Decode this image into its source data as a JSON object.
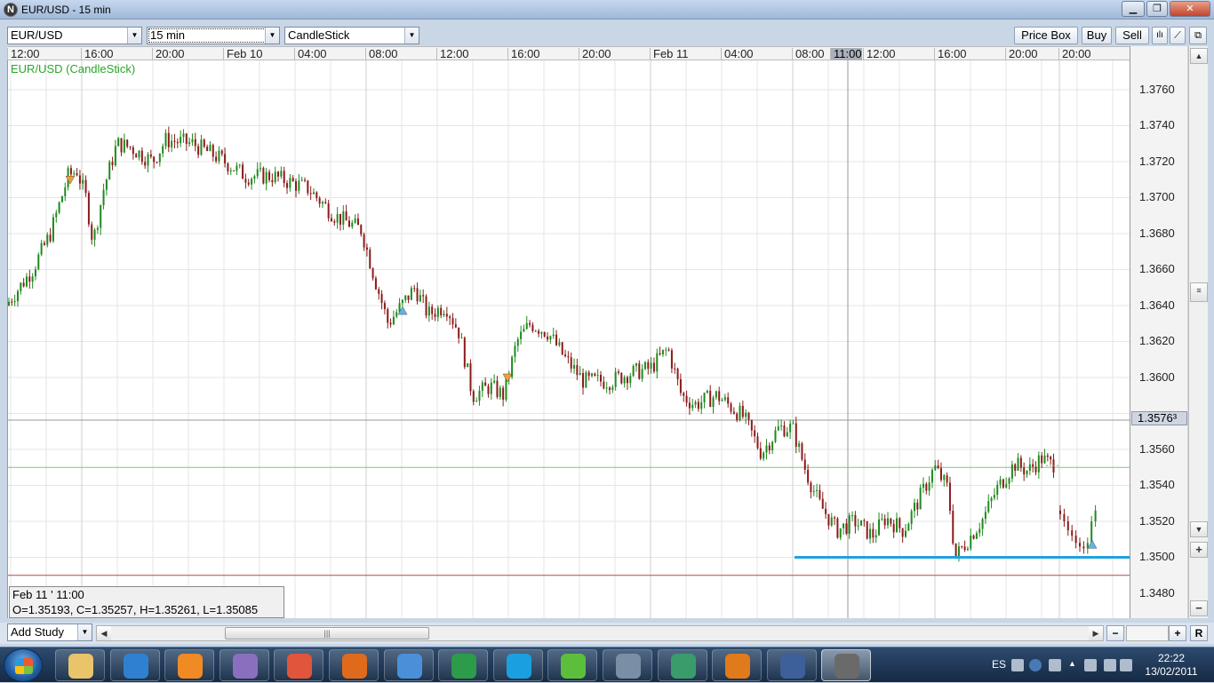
{
  "window": {
    "title": "EUR/USD - 15 min",
    "controls": {
      "minimize": "▁",
      "maximize": "❐",
      "close": "✕"
    }
  },
  "toolbar": {
    "symbol": "EUR/USD",
    "interval": "15 min",
    "chart_type": "CandleStick",
    "price_box_label": "Price Box",
    "buy_label": "Buy",
    "sell_label": "Sell"
  },
  "chart": {
    "series_label": "EUR/USD (CandleStick)",
    "time_labels": [
      "12:00",
      "16:00",
      "20:00",
      "Feb 10",
      "04:00",
      "08:00",
      "12:00",
      "16:00",
      "20:00",
      "Feb 11",
      "04:00",
      "08:00",
      "11:00",
      "12:00",
      "16:00",
      "20:00",
      "20:00"
    ],
    "highlighted_time": "11:00",
    "price_labels": [
      "1.3760",
      "1.3740",
      "1.3720",
      "1.3700",
      "1.3680",
      "1.3660",
      "1.3640",
      "1.3620",
      "1.3600",
      "1.3560",
      "1.3540",
      "1.3520",
      "1.3500",
      "1.3480"
    ],
    "current_price": "1.3576³",
    "support_level": 1.35,
    "colors": {
      "bull": "#1f8a1f",
      "bear": "#8b1a1a",
      "support_line": "#1fa3e0",
      "green_line": "#7dc87d",
      "red_line": "#b04a4a",
      "grid": "#e6e6e6"
    }
  },
  "ohlc_info": {
    "date": "Feb 11 ' 11:00",
    "values": "O=1.35193, C=1.35257, H=1.35261, L=1.35085"
  },
  "bottom": {
    "add_study_label": "Add Study",
    "scroll_thumb": "|||",
    "zoom_out": "−",
    "zoom_in": "+",
    "reset": "R"
  },
  "taskbar": {
    "apps": [
      "file-explorer",
      "internet-explorer",
      "media-player",
      "paint",
      "windows-live",
      "firefox",
      "calculator",
      "excel",
      "skype",
      "icq",
      "app-window",
      "network-app",
      "firefox-alt",
      "security-app",
      "trading-app"
    ],
    "language": "ES",
    "time": "22:22",
    "date": "13/02/2011"
  }
}
